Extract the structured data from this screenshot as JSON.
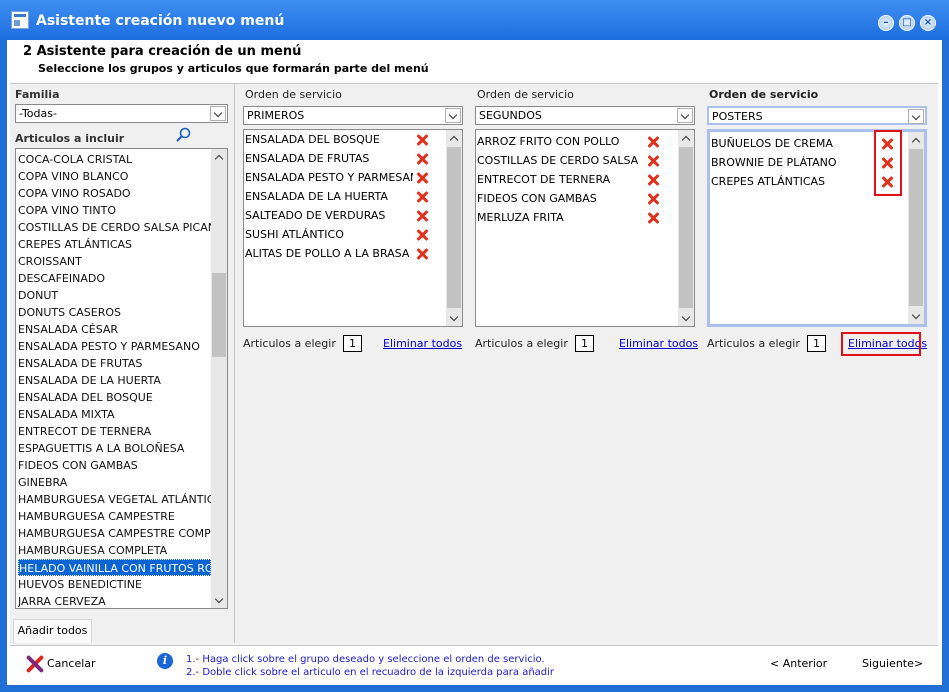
{
  "window": {
    "title": "Asistente creación nuevo menú"
  },
  "header": {
    "step_title": "2 Asistente para creación de un menú",
    "step_subtitle": "Seleccione los grupos y articulos que formarán parte del menú"
  },
  "left_panel": {
    "family_label": "Familia",
    "family_value": "-Todas-",
    "articles_label": "Articulos a incluir",
    "articles": [
      "COCA-COLA CRISTAL",
      "COPA VINO BLANCO",
      "COPA VINO ROSADO",
      "COPA VINO TINTO",
      "COSTILLAS DE CERDO SALSA PICANTE",
      "CREPES ATLÁNTICAS",
      "CROISSANT",
      "DESCAFEINADO",
      "DONUT",
      "DONUTS CASEROS",
      "ENSALADA CÉSAR",
      "ENSALADA PESTO Y PARMESANO",
      "ENSALADA DE FRUTAS",
      "ENSALADA DE LA HUERTA",
      "ENSALADA DEL BOSQUE",
      "ENSALADA MIXTA",
      "ENTRECOT DE TERNERA",
      "ESPAGUETTIS A LA BOLOÑESA",
      "FIDEOS CON GAMBAS",
      "GINEBRA",
      "HAMBURGUESA VEGETAL ATLÁNTICA",
      "HAMBURGUESA CAMPESTRE",
      "HAMBURGUESA CAMPESTRE COMPLETA",
      "HAMBURGUESA COMPLETA",
      "HELADO VAINILLA CON FRUTOS ROJOS",
      "HUEVOS BENEDICTINE",
      "JARRA CERVEZA"
    ],
    "selected_index": 24,
    "add_all_label": "Añadir todos"
  },
  "columns": [
    {
      "label": "Orden de servicio",
      "group": "PRIMEROS",
      "items": [
        "ENSALADA DEL BOSQUE",
        "ENSALADA DE FRUTAS",
        "ENSALADA PESTO Y PARMESANO",
        "ENSALADA DE LA HUERTA",
        "SALTEADO DE VERDURAS",
        "SUSHI ATLÁNTICO",
        "ALITAS DE POLLO A LA BRASA"
      ],
      "choose_label": "Articulos a elegir",
      "choose_count": "1",
      "remove_all_label": "Eliminar todos"
    },
    {
      "label": "Orden de servicio",
      "group": "SEGUNDOS",
      "items": [
        "ARROZ FRITO CON POLLO",
        "COSTILLAS DE CERDO SALSA PICANTE",
        "ENTRECOT DE TERNERA",
        "FIDEOS CON GAMBAS",
        "MERLUZA FRITA"
      ],
      "choose_label": "Articulos a elegir",
      "choose_count": "1",
      "remove_all_label": "Eliminar todos"
    },
    {
      "label": "Orden de servicio",
      "group": "POSTERS",
      "items": [
        "BUÑUELOS DE CREMA",
        "BROWNIE DE PLÁTANO",
        "CREPES ATLÁNTICAS"
      ],
      "choose_label": "Articulos a elegir",
      "choose_count": "1",
      "remove_all_label": "Eliminar todos"
    }
  ],
  "footer": {
    "cancel_label": "Cancelar",
    "hint_1": "1.- Haga click sobre el grupo deseado y seleccione el orden de servicio.",
    "hint_2": "2.- Doble click sobre el articulo en el recuadro de la izquierda para añadir",
    "prev_label": "< Anterior",
    "next_label": "Siguiente>"
  },
  "colors": {
    "titlebar": "#1d6fe0",
    "selection": "#0a64d4",
    "delete_icon": "#e0301e",
    "highlight_box": "#e0101a",
    "link": "#0000cc",
    "hint_text": "#1c1cc0"
  }
}
